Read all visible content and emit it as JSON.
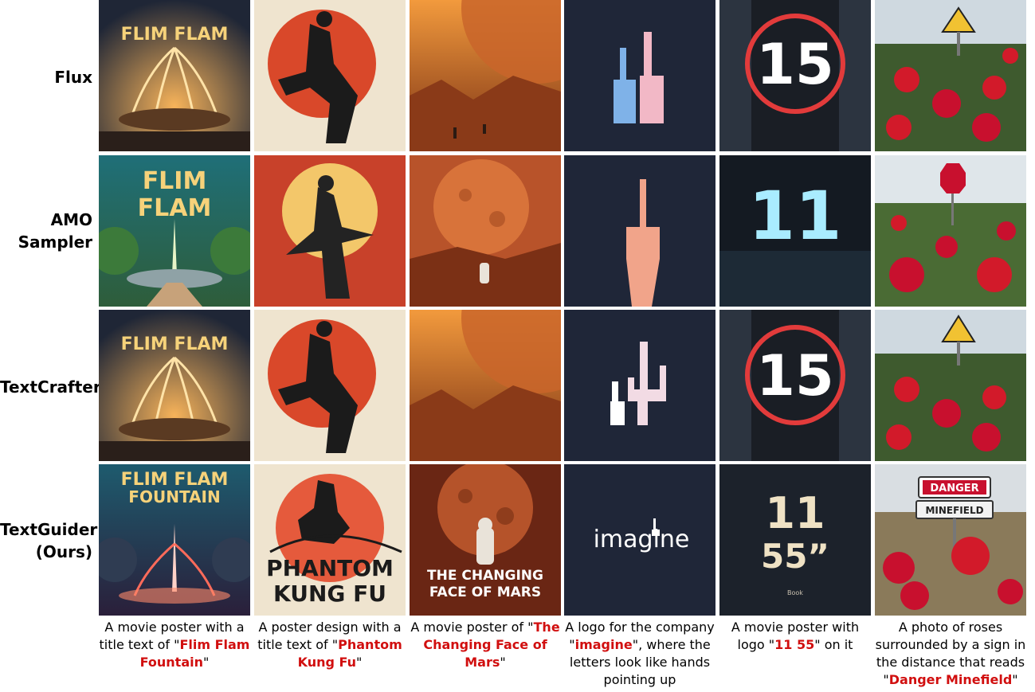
{
  "rows": [
    {
      "label_lines": [
        "Flux"
      ]
    },
    {
      "label_lines": [
        "AMO",
        "Sampler"
      ]
    },
    {
      "label_lines": [
        "TextCrafter"
      ]
    },
    {
      "label_lines": [
        "TextGuider",
        "(Ours)"
      ]
    }
  ],
  "tile_text": {
    "flim_flam": "FLIM FLAM",
    "flim": "FLIM",
    "flam": "FLAM",
    "fountain": "FOUNTAIN",
    "phantom": "PHANTOM",
    "kung_fu": "KUNG FU",
    "changing_1": "THE CHANGING",
    "changing_2": "FACE OF MARS",
    "imagine": "imagine",
    "num_15": "15",
    "num_11": "11",
    "num_55": "55”",
    "book": "Book",
    "danger": "DANGER",
    "minefield": "MINEFIELD",
    "danger_small": "DANGER",
    "minefield_small": "MINEFIELD"
  },
  "captions": [
    {
      "pre": "A movie poster with a title text of \"",
      "hl": "Flim Flam Fountain",
      "post": "\""
    },
    {
      "pre": "A poster design with a title text of \"",
      "hl": "Phantom Kung Fu",
      "post": "\""
    },
    {
      "pre": "A movie poster of \"",
      "hl": "The Changing Face of Mars",
      "post": "\""
    },
    {
      "pre": "A logo for the company \"",
      "hl": "imagine",
      "post": "\", where the letters look like hands pointing up"
    },
    {
      "pre": "A movie poster with logo \"",
      "hl": "11 55",
      "post": "\" on it"
    },
    {
      "pre": "A photo of roses surrounded by a sign in the distance that reads \"",
      "hl": "Danger Minefield",
      "post": "\""
    }
  ],
  "colors": {
    "highlight": "#d10f0f",
    "title_gold": "#f6d27a"
  }
}
